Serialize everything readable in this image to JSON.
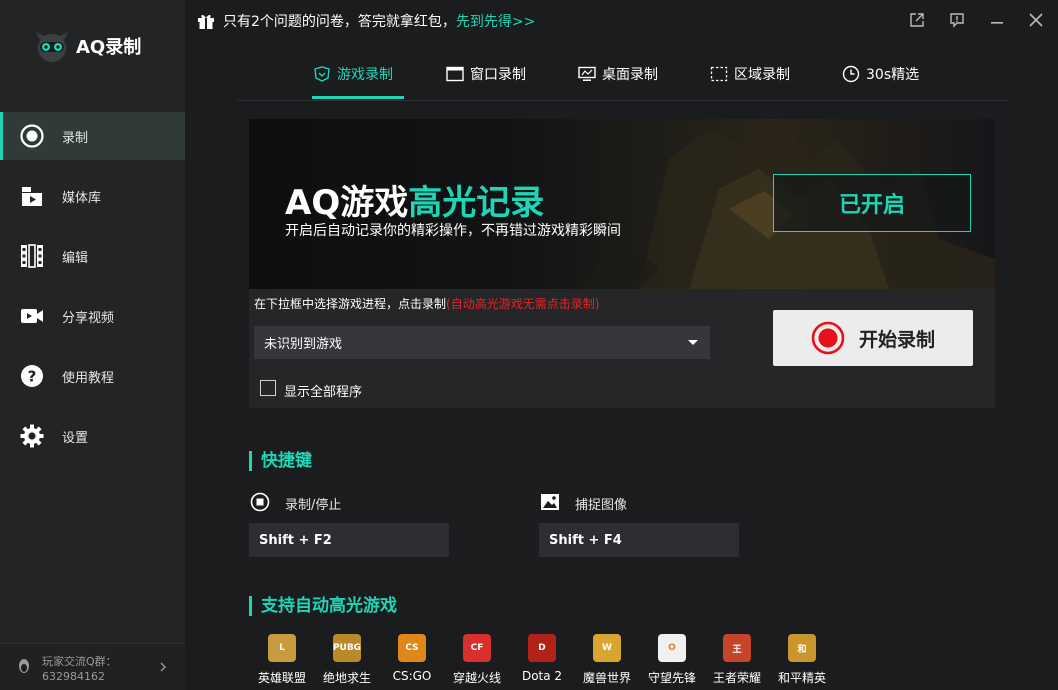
{
  "app": {
    "name": "AQ录制"
  },
  "sidebar": {
    "items": [
      {
        "label": "录制",
        "icon": "record-icon",
        "active": true
      },
      {
        "label": "媒体库",
        "icon": "media-library-icon",
        "active": false
      },
      {
        "label": "编辑",
        "icon": "film-edit-icon",
        "active": false
      },
      {
        "label": "分享视频",
        "icon": "video-share-icon",
        "active": false
      },
      {
        "label": "使用教程",
        "icon": "help-icon",
        "active": false
      },
      {
        "label": "设置",
        "icon": "gear-icon",
        "active": false
      }
    ],
    "footer": {
      "line1": "玩家交流Q群：",
      "line2": "632984162"
    }
  },
  "notice": {
    "text": "只有2个问题的问卷，答完就拿红包，",
    "link": "先到先得>>"
  },
  "tabs": [
    {
      "label": "游戏录制",
      "icon": "game-shield-icon",
      "active": true
    },
    {
      "label": "窗口录制",
      "icon": "window-icon",
      "active": false
    },
    {
      "label": "桌面录制",
      "icon": "desktop-icon",
      "active": false
    },
    {
      "label": "区域录制",
      "icon": "region-icon",
      "active": false
    },
    {
      "label": "30s精选",
      "icon": "clock-icon",
      "active": false
    }
  ],
  "banner": {
    "title_white": "AQ游戏",
    "title_accent": "高光记录",
    "subtitle": "开启后自动记录你的精彩操作，不再错过游戏精彩瞬间",
    "status_button": "已开启"
  },
  "panel": {
    "hint": "在下拉框中选择游戏进程，点击录制",
    "hint_red": "(自动高光游戏无需点击录制)",
    "select_value": "未识别到游戏",
    "checkbox_label": "显示全部程序",
    "record_button": "开始录制"
  },
  "shortcuts": {
    "title": "快捷键",
    "record": {
      "label": "录制/停止",
      "key": "Shift + F2"
    },
    "capture": {
      "label": "捕捉图像",
      "key": "Shift + F4"
    }
  },
  "games": {
    "title": "支持自动高光游戏",
    "items": [
      {
        "label": "英雄联盟",
        "color": "#c89b3c",
        "mark": "L"
      },
      {
        "label": "绝地求生",
        "color": "#b88a2a",
        "mark": "PUBG"
      },
      {
        "label": "CS:GO",
        "color": "#e0871a",
        "mark": "CS"
      },
      {
        "label": "穿越火线",
        "color": "#d8302c",
        "mark": "CF"
      },
      {
        "label": "Dota 2",
        "color": "#b32218",
        "mark": "D"
      },
      {
        "label": "魔兽世界",
        "color": "#d8a531",
        "mark": "W"
      },
      {
        "label": "守望先锋",
        "color": "#f0f0f0",
        "mark": "O"
      },
      {
        "label": "王者荣耀",
        "color": "#c6452a",
        "mark": "王"
      },
      {
        "label": "和平精英",
        "color": "#c9962e",
        "mark": "和"
      }
    ]
  },
  "colors": {
    "accent": "#1ed6b6",
    "warning": "#e0262b",
    "record_red": "#e8101a"
  }
}
